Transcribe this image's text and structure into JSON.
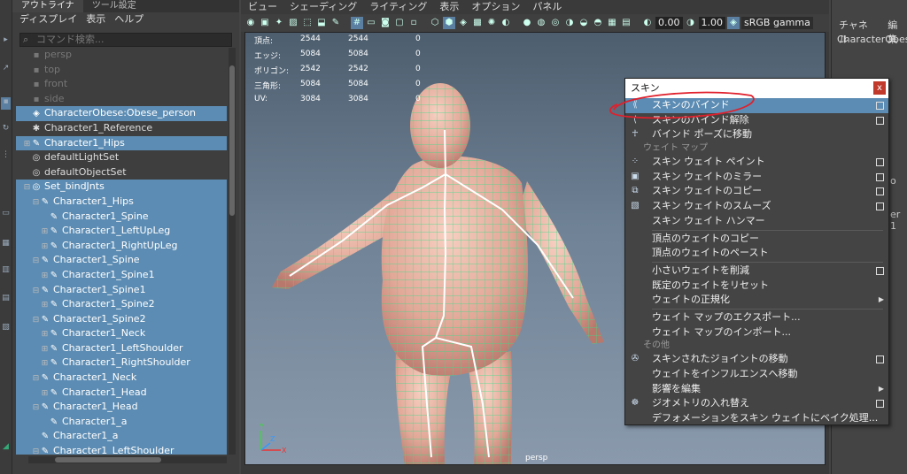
{
  "outliner": {
    "tabs": [
      "アウトライナ",
      "ツール設定"
    ],
    "menu": [
      "ディスプレイ",
      "表示",
      "ヘルプ"
    ],
    "search_placeholder": "コマンド検索...",
    "rows": [
      {
        "label": "persp",
        "icon": "camera-icon"
      },
      {
        "label": "top",
        "icon": "camera-icon"
      },
      {
        "label": "front",
        "icon": "camera-icon"
      },
      {
        "label": "side",
        "icon": "camera-icon"
      },
      {
        "label": "CharacterObese:Obese_person",
        "icon": "mesh-icon"
      },
      {
        "label": "Character1_Reference",
        "icon": "reference-icon"
      },
      {
        "label": "Character1_Hips",
        "icon": "joint-icon"
      },
      {
        "label": "defaultLightSet",
        "icon": "set-icon"
      },
      {
        "label": "defaultObjectSet",
        "icon": "set-icon"
      },
      {
        "label": "Set_bindJnts",
        "icon": "set-icon"
      },
      {
        "label": "Character1_Hips",
        "icon": "joint-icon"
      },
      {
        "label": "Character1_Spine",
        "icon": "joint-icon"
      },
      {
        "label": "Character1_LeftUpLeg",
        "icon": "joint-icon"
      },
      {
        "label": "Character1_RightUpLeg",
        "icon": "joint-icon"
      },
      {
        "label": "Character1_Spine",
        "icon": "joint-icon"
      },
      {
        "label": "Character1_Spine1",
        "icon": "joint-icon"
      },
      {
        "label": "Character1_Spine1",
        "icon": "joint-icon"
      },
      {
        "label": "Character1_Spine2",
        "icon": "joint-icon"
      },
      {
        "label": "Character1_Spine2",
        "icon": "joint-icon"
      },
      {
        "label": "Character1_Neck",
        "icon": "joint-icon"
      },
      {
        "label": "Character1_LeftShoulder",
        "icon": "joint-icon"
      },
      {
        "label": "Character1_RightShoulder",
        "icon": "joint-icon"
      },
      {
        "label": "Character1_Neck",
        "icon": "joint-icon"
      },
      {
        "label": "Character1_Head",
        "icon": "joint-icon"
      },
      {
        "label": "Character1_Head",
        "icon": "joint-icon"
      },
      {
        "label": "Character1_a",
        "icon": "joint-icon"
      },
      {
        "label": "Character1_a",
        "icon": "joint-icon"
      },
      {
        "label": "Character1_LeftShoulder",
        "icon": "joint-icon"
      }
    ]
  },
  "viewport": {
    "menu": [
      "ビュー",
      "シェーディング",
      "ライティング",
      "表示",
      "オプション",
      "パネル"
    ],
    "exposure": "0.00",
    "gamma": "1.00",
    "color_space": "sRGB gamma",
    "camera": "persp",
    "hud": [
      {
        "label": "頂点:",
        "v1": "2544",
        "v2": "2544",
        "v3": "0"
      },
      {
        "label": "エッジ:",
        "v1": "5084",
        "v2": "5084",
        "v3": "0"
      },
      {
        "label": "ポリゴン:",
        "v1": "2542",
        "v2": "2542",
        "v3": "0"
      },
      {
        "label": "三角形:",
        "v1": "5084",
        "v2": "5084",
        "v3": "0"
      },
      {
        "label": "UV:",
        "v1": "3084",
        "v2": "3084",
        "v3": "0"
      }
    ]
  },
  "channel": {
    "menu": [
      "チャネル",
      "編集"
    ],
    "object": "CharacterObese",
    "frag1": "o",
    "frag2": "er 1"
  },
  "skin_menu": {
    "title": "スキン",
    "close": "x",
    "items": [
      {
        "type": "item",
        "label": "スキンのバインド",
        "icon": "bind-skin-icon",
        "option": true,
        "highlight": true
      },
      {
        "type": "item",
        "label": "スキンのバインド解除",
        "icon": "unbind-skin-icon",
        "option": true
      },
      {
        "type": "item",
        "label": "バインド ポーズに移動",
        "icon": "bind-pose-icon"
      },
      {
        "type": "section",
        "label": "ウェイト マップ"
      },
      {
        "type": "item",
        "label": "スキン ウェイト ペイント",
        "icon": "paint-weights-icon",
        "option": true
      },
      {
        "type": "item",
        "label": "スキン ウェイトのミラー",
        "icon": "mirror-weights-icon",
        "option": true
      },
      {
        "type": "item",
        "label": "スキン ウェイトのコピー",
        "icon": "copy-weights-icon",
        "option": true
      },
      {
        "type": "item",
        "label": "スキン ウェイトのスムーズ",
        "icon": "smooth-weights-icon",
        "option": true
      },
      {
        "type": "item",
        "label": "スキン ウェイト ハンマー"
      },
      {
        "type": "divider"
      },
      {
        "type": "item",
        "label": "頂点のウェイトのコピー"
      },
      {
        "type": "item",
        "label": "頂点のウェイトのペースト"
      },
      {
        "type": "divider"
      },
      {
        "type": "item",
        "label": "小さいウェイトを削減",
        "option": true
      },
      {
        "type": "item",
        "label": "既定のウェイトをリセット"
      },
      {
        "type": "item",
        "label": "ウェイトの正規化",
        "submenu": true
      },
      {
        "type": "divider"
      },
      {
        "type": "item",
        "label": "ウェイト マップのエクスポート..."
      },
      {
        "type": "item",
        "label": "ウェイト マップのインポート..."
      },
      {
        "type": "section",
        "label": "その他"
      },
      {
        "type": "item",
        "label": "スキンされたジョイントの移動",
        "icon": "move-joints-icon",
        "option": true
      },
      {
        "type": "item",
        "label": "ウェイトをインフルエンスへ移動"
      },
      {
        "type": "item",
        "label": "影響を編集",
        "submenu": true
      },
      {
        "type": "item",
        "label": "ジオメトリの入れ替え",
        "icon": "swap-geometry-icon",
        "option": true
      },
      {
        "type": "item",
        "label": "デフォメーションをスキン ウェイトにベイク処理..."
      }
    ]
  },
  "colors": {
    "selection": "#5c8cb3",
    "mesh": "#35e08a",
    "skin": "#e2a898",
    "annotation": "#e0202c"
  }
}
